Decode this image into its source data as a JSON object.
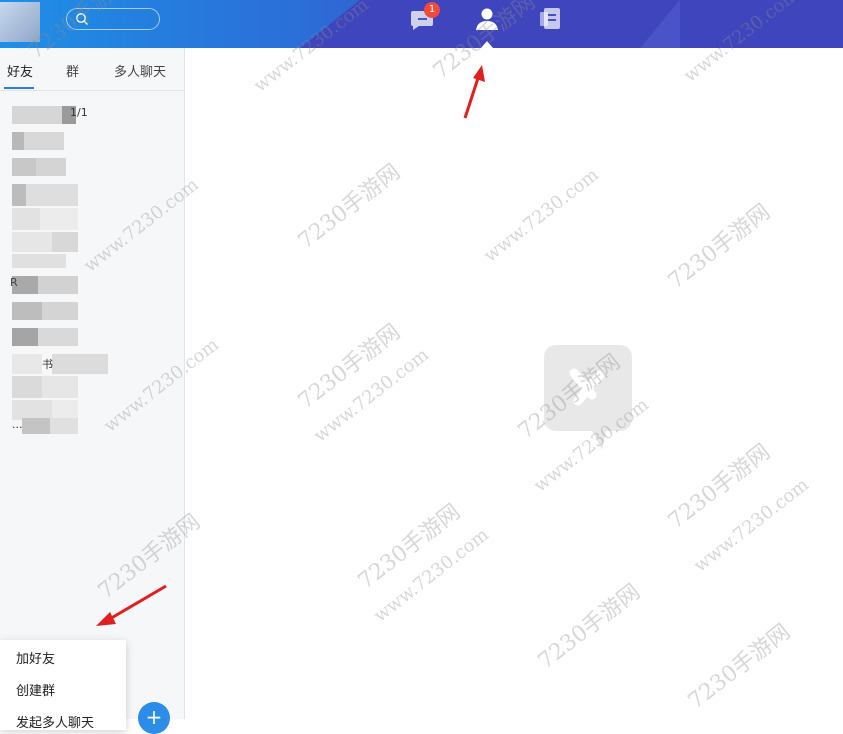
{
  "header": {
    "search_placeholder": "",
    "nav": [
      {
        "name": "messages",
        "badge": "1"
      },
      {
        "name": "contacts"
      },
      {
        "name": "files"
      }
    ]
  },
  "sidebar": {
    "tabs": [
      "好友",
      "群",
      "多人聊天"
    ],
    "active_tab": "好友",
    "contacts": [
      {
        "label": "1/1"
      },
      {
        "label": ""
      },
      {
        "label": ""
      },
      {
        "label": ""
      },
      {
        "label": ""
      },
      {
        "label": ""
      },
      {
        "label": ""
      },
      {
        "label": "R"
      },
      {
        "label": ""
      },
      {
        "label": ""
      },
      {
        "label": "书"
      },
      {
        "label": ""
      },
      {
        "label": ""
      },
      {
        "label": "..."
      }
    ]
  },
  "context_menu": {
    "items": [
      "加好友",
      "创建群",
      "发起多人聊天"
    ]
  },
  "fab": {
    "label": "+"
  },
  "watermark": {
    "text_cn": "7230手游网",
    "text_url": "www.7230.com"
  },
  "colors": {
    "accent": "#2b8de8",
    "badge": "#f04a3a",
    "header_left": "#1e8fe6",
    "header_right": "#3f46bd"
  }
}
